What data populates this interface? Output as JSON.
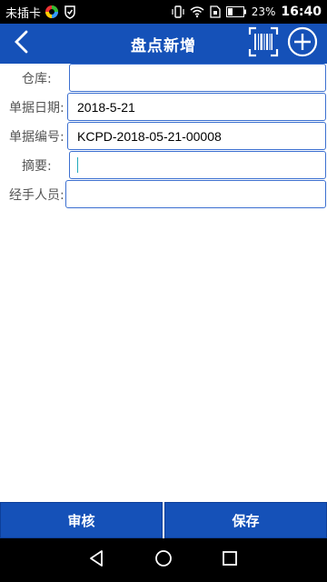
{
  "status_bar": {
    "carrier": "未插卡",
    "battery_percent": "23%",
    "time": "16:40"
  },
  "header": {
    "title": "盘点新增"
  },
  "form": {
    "warehouse": {
      "label": "仓库:",
      "value": ""
    },
    "doc_date": {
      "label": "单据日期:",
      "value": "2018-5-21"
    },
    "doc_number": {
      "label": "单据编号:",
      "value": "KCPD-2018-05-21-00008"
    },
    "summary": {
      "label": "摘要:",
      "value": ""
    },
    "handler": {
      "label": "经手人员:",
      "value": ""
    }
  },
  "actions": {
    "audit_label": "审核",
    "save_label": "保存"
  },
  "colors": {
    "primary": "#1551b8",
    "field_border": "#3b6fd0"
  }
}
